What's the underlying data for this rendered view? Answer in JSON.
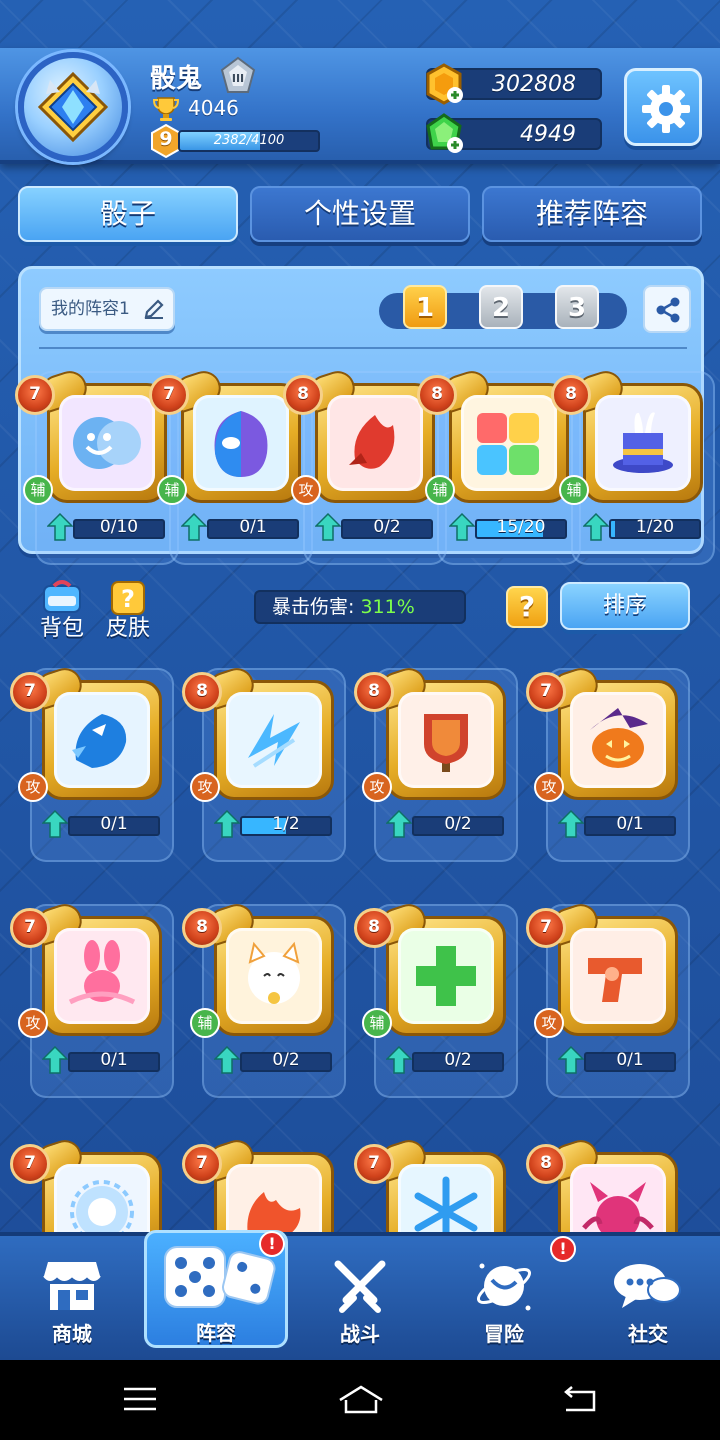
{
  "player": {
    "name": "骰鬼",
    "trophies": "4046",
    "level": "9",
    "xp_text": "2382/4100",
    "xp_progress": 0.58
  },
  "currency": {
    "gold": "302808",
    "gems": "4949"
  },
  "tabs": [
    {
      "label": "骰子",
      "active": true
    },
    {
      "label": "个性设置",
      "active": false
    },
    {
      "label": "推荐阵容",
      "active": false
    }
  ],
  "deck": {
    "name_label": "我的阵容1",
    "slots": [
      "1",
      "2",
      "3"
    ],
    "active_slot": "1",
    "cards": [
      {
        "name": "comedy-masks-dice",
        "level": "7",
        "role": "辅",
        "count": "0/10",
        "progress": 0.0
      },
      {
        "name": "masked-hero-dice",
        "level": "7",
        "role": "辅",
        "count": "0/1",
        "progress": 0.0
      },
      {
        "name": "rocket-dice",
        "level": "8",
        "role": "攻",
        "count": "0/2",
        "progress": 0.0
      },
      {
        "name": "puzzle-dice",
        "level": "8",
        "role": "辅",
        "count": "15/20",
        "progress": 0.75
      },
      {
        "name": "magic-hat-dice",
        "level": "8",
        "role": "辅",
        "count": "1/20",
        "progress": 0.05
      }
    ]
  },
  "toolbar": {
    "bag_label": "背包",
    "skin_label": "皮肤",
    "crit_label": "暴击伤害:",
    "crit_value": "311%",
    "help_label": "?",
    "sort_label": "排序"
  },
  "collection": [
    {
      "name": "dragon-dice",
      "level": "7",
      "role": "攻",
      "count": "0/1",
      "progress": 0.0
    },
    {
      "name": "lightning-dice",
      "level": "8",
      "role": "攻",
      "count": "1/2",
      "progress": 0.5
    },
    {
      "name": "shield-totem-dice",
      "level": "8",
      "role": "攻",
      "count": "0/2",
      "progress": 0.0
    },
    {
      "name": "pumpkin-witch-dice",
      "level": "7",
      "role": "攻",
      "count": "0/1",
      "progress": 0.0
    },
    {
      "name": "ribbon-rabbit-dice",
      "level": "7",
      "role": "攻",
      "count": "0/1",
      "progress": 0.0
    },
    {
      "name": "lucky-cat-dice",
      "level": "8",
      "role": "辅",
      "count": "0/2",
      "progress": 0.0
    },
    {
      "name": "heal-cross-dice",
      "level": "8",
      "role": "辅",
      "count": "0/2",
      "progress": 0.0
    },
    {
      "name": "revolver-dice",
      "level": "7",
      "role": "攻",
      "count": "0/1",
      "progress": 0.0
    },
    {
      "name": "light-gear-dice",
      "level": "7",
      "role": "",
      "count": "",
      "progress": 0.0
    },
    {
      "name": "flame-dice",
      "level": "7",
      "role": "",
      "count": "",
      "progress": 0.0
    },
    {
      "name": "snowflake-dice",
      "level": "7",
      "role": "",
      "count": "",
      "progress": 0.0
    },
    {
      "name": "demon-dice",
      "level": "8",
      "role": "",
      "count": "",
      "progress": 0.0
    }
  ],
  "nav": [
    {
      "label": "商城",
      "icon": "shop-icon",
      "active": false,
      "badge": ""
    },
    {
      "label": "阵容",
      "icon": "dice-icon",
      "active": true,
      "badge": "!"
    },
    {
      "label": "战斗",
      "icon": "crossed-swords-icon",
      "active": false,
      "badge": ""
    },
    {
      "label": "冒险",
      "icon": "planet-icon",
      "active": false,
      "badge": "!"
    },
    {
      "label": "社交",
      "icon": "chat-icon",
      "active": false,
      "badge": ""
    }
  ],
  "colors": {
    "background": "#1f4f9a",
    "accent": "#4aa4f3",
    "gold": "#f0a112",
    "attack_role": "#d8641f",
    "support_role": "#47b54b",
    "crit_value": "#7dff4a"
  }
}
